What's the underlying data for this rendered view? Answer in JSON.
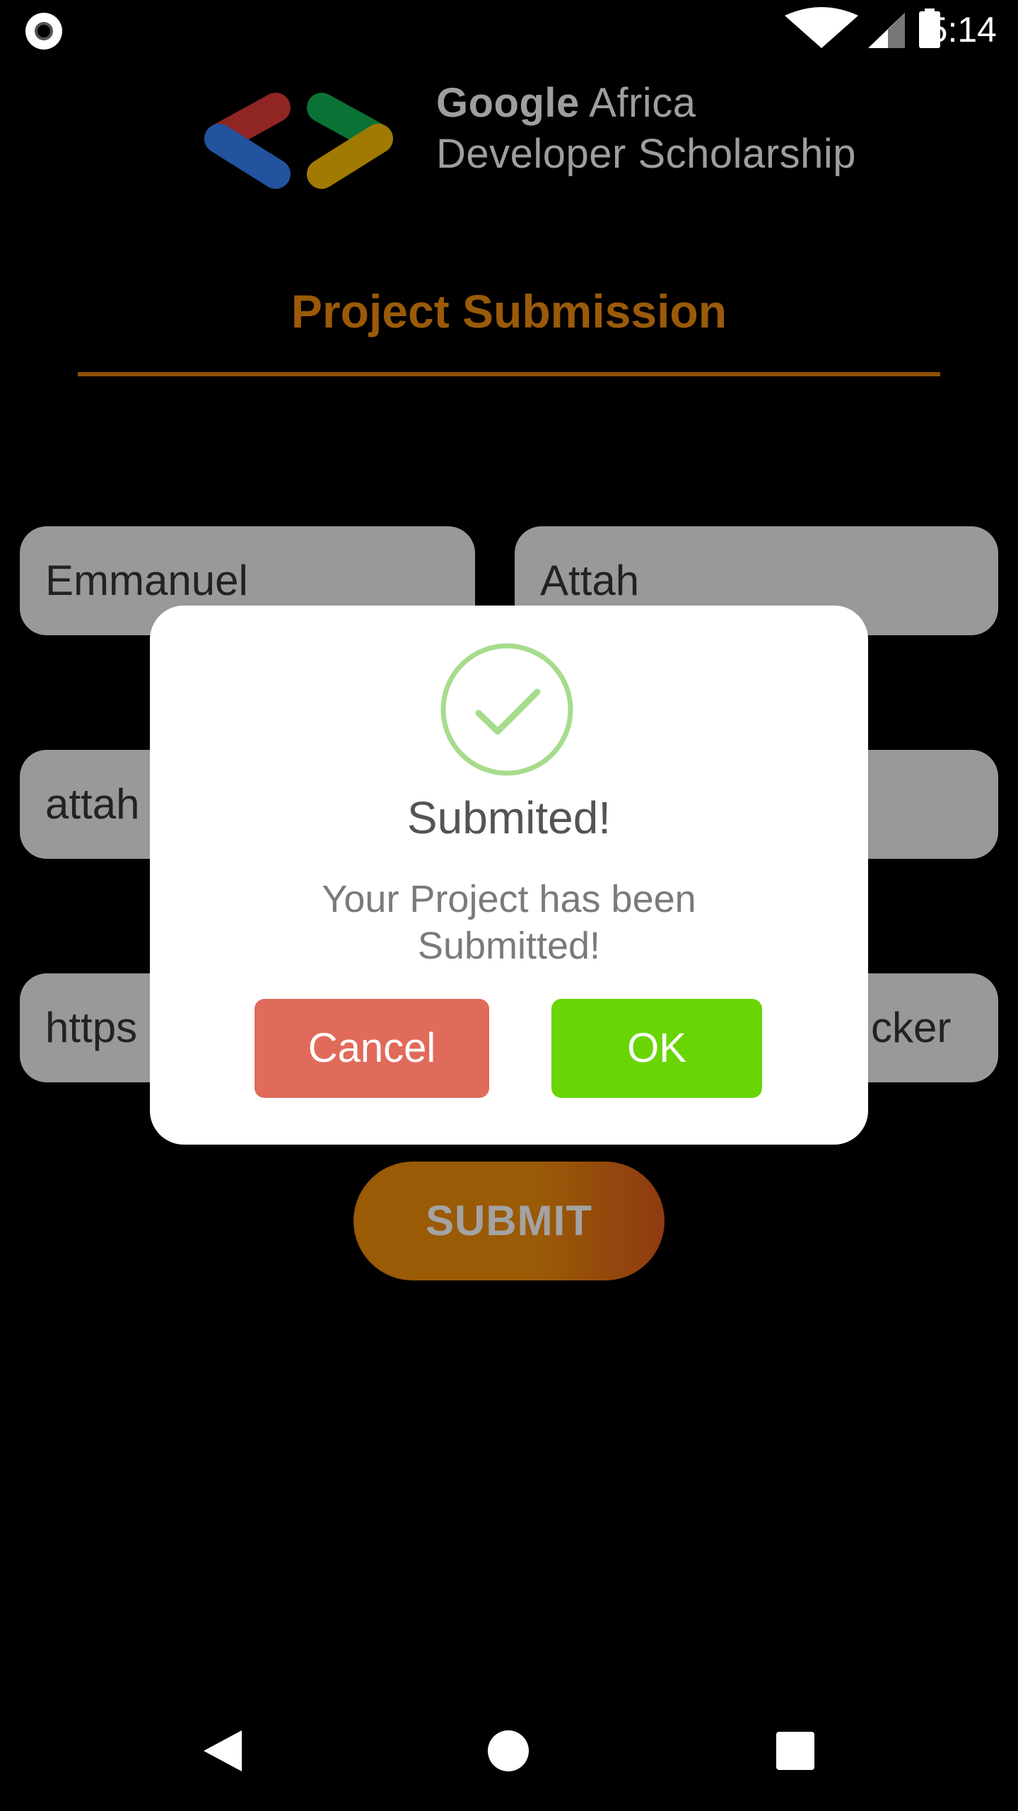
{
  "status_bar": {
    "time": "5:14",
    "icons": [
      "screen-record-icon",
      "wifi-icon",
      "cell-signal-icon",
      "battery-icon"
    ]
  },
  "header": {
    "brand_bold": "Google",
    "brand_rest": " Africa",
    "brand_line2": "Developer Scholarship"
  },
  "page": {
    "title": "Project Submission"
  },
  "form": {
    "first_name": "Emmanuel",
    "last_name": "Attah",
    "email_visible": "attah",
    "link_visible_start": "https",
    "link_visible_end": "cker",
    "submit_label": "SUBMIT"
  },
  "dialog": {
    "title": "Submited!",
    "message_line1": "Your Project has been",
    "message_line2": "Submitted!",
    "cancel_label": "Cancel",
    "ok_label": "OK"
  },
  "colors": {
    "accent": "#9a5a09",
    "cancel": "#e06b5b",
    "ok": "#6ad505",
    "check": "#a6dc8b"
  },
  "nav_bar": {
    "items": [
      "back-icon",
      "home-icon",
      "recents-icon"
    ]
  }
}
